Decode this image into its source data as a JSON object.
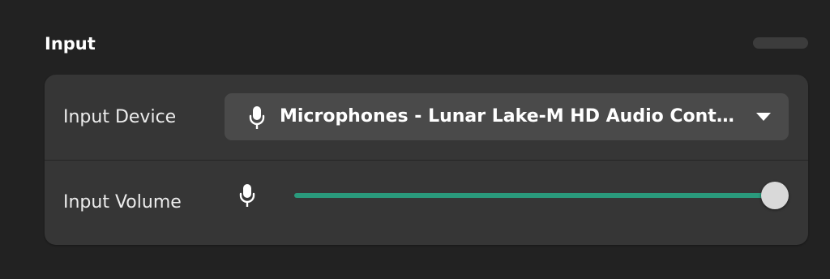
{
  "section": {
    "title": "Input"
  },
  "device": {
    "label": "Input Device",
    "selected": "Microphones - Lunar Lake-M HD Audio Controller",
    "icon": "microphone-icon",
    "caret_icon": "chevron-down-icon"
  },
  "volume": {
    "label": "Input Volume",
    "icon": "microphone-icon",
    "level": 1.0
  },
  "colors": {
    "background": "#222222",
    "card": "#363636",
    "dropdown": "#4a4a4a",
    "accent": "#2a9a7c",
    "thumb": "#d9d9d9"
  }
}
